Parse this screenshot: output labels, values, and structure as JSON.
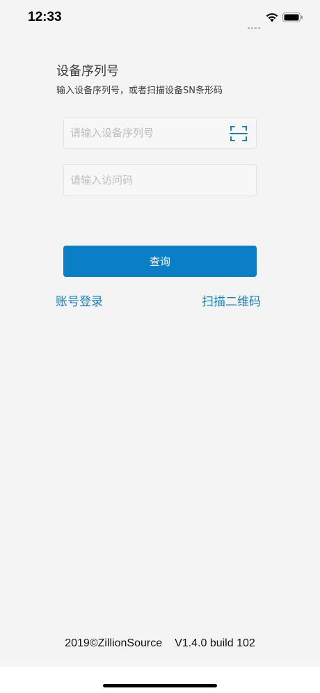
{
  "status_bar": {
    "time": "12:33"
  },
  "form": {
    "title": "设备序列号",
    "subtitle": "输入设备序列号，或者扫描设备SN条形码",
    "serial_input": {
      "placeholder": "请输入设备序列号",
      "value": ""
    },
    "access_code_input": {
      "placeholder": "请输入访问码",
      "value": ""
    },
    "query_label": "查询"
  },
  "links": {
    "account_login": "账号登录",
    "scan_qr": "扫描二维码"
  },
  "footer": {
    "copyright": "2019©ZillionSource",
    "version": "V1.4.0 build 102"
  },
  "colors": {
    "accent": "#0b7fc6",
    "link": "#1a7fc0",
    "background": "#f4f4f5"
  },
  "icons": {
    "scan": "scan-barcode-icon",
    "wifi": "wifi-icon",
    "battery": "battery-icon"
  }
}
